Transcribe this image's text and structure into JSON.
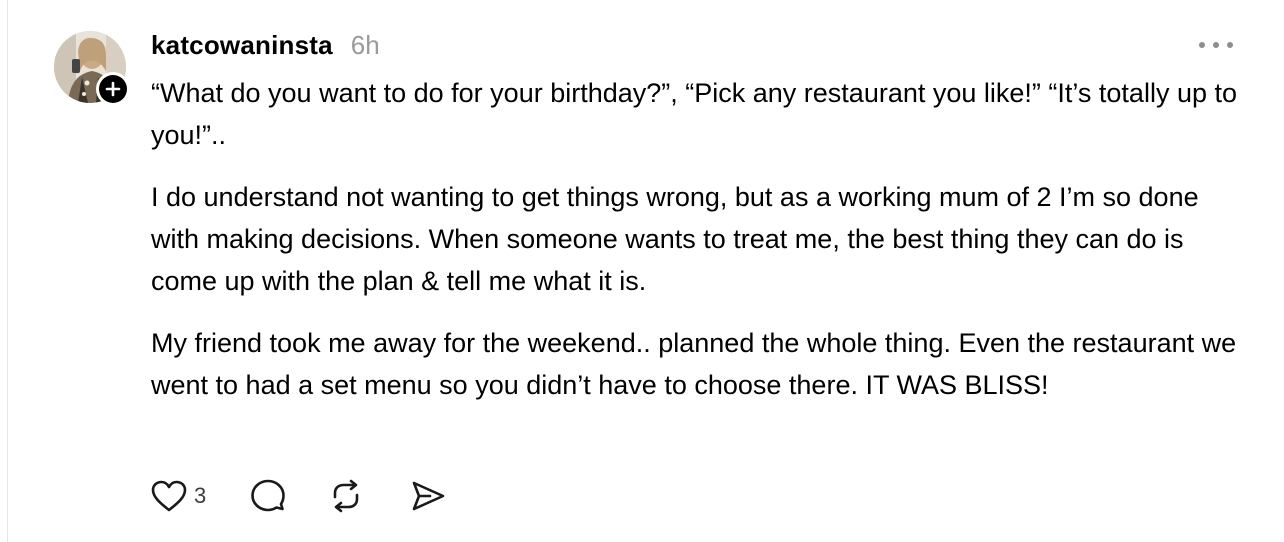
{
  "post": {
    "username": "katcowaninsta",
    "time_ago": "6h",
    "paragraphs": [
      "“What do you want to do for your birthday?”, “Pick any restaurant you like!” “It’s totally up to you!”..",
      "I do understand not wanting to get things wrong, but as a working mum of 2 I’m so done with making decisions. When someone wants to treat me, the best thing they can do is come up with the plan & tell me what it is.",
      "My friend took me away for the weekend.. planned the whole thing. Even the restaurant we went to had a set menu so you didn’t have to choose there. IT WAS BLISS!"
    ],
    "like_count": "3"
  },
  "icons": {
    "follow": "plus-icon",
    "more": "more-dots-icon",
    "like": "heart-icon",
    "reply": "comment-icon",
    "repost": "repost-icon",
    "share": "send-icon"
  },
  "colors": {
    "text": "#000000",
    "muted": "#9a9a9a",
    "icon": "#1a1a1a"
  }
}
